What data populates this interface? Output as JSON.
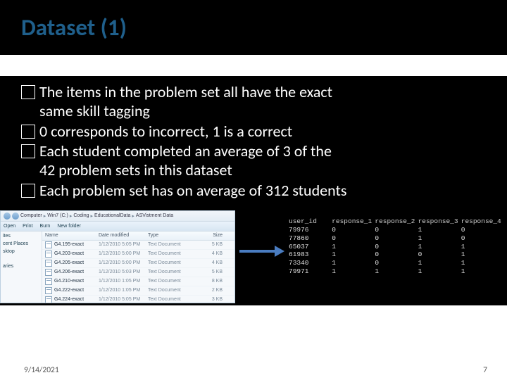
{
  "title": "Dataset (1)",
  "bullets": [
    {
      "first": "The items in the problem set all have the exact",
      "cont": "same skill tagging"
    },
    {
      "first": "0 corresponds to incorrect, 1 is a correct",
      "cont": ""
    },
    {
      "first": "Each student completed an average of 3 of the",
      "cont": "42 problem sets in this dataset"
    },
    {
      "first": "Each problem set has on average of 312 students",
      "cont": ""
    }
  ],
  "explorer": {
    "breadcrumb": [
      "Computer",
      "Win7 (C:)",
      "Coding",
      "EducationalData",
      "ASVistment Data"
    ],
    "toolbar": {
      "open": "Open",
      "print": "Print",
      "burn": "Burn",
      "newfolder": "New folder"
    },
    "sidebar": {
      "group1": "ites",
      "item1": "cent Places",
      "item2": "sktop",
      "group2": "aries"
    },
    "headers": {
      "name": "Name",
      "date": "Date modified",
      "type": "Type",
      "size": "Size"
    },
    "files": [
      {
        "name": "G4.195-exact",
        "date": "1/12/2010 5:05 PM",
        "type": "Text Document",
        "size": "5 KB"
      },
      {
        "name": "G4.203-exact",
        "date": "1/12/2010 5:00 PM",
        "type": "Text Document",
        "size": "4 KB"
      },
      {
        "name": "G4.205-exact",
        "date": "1/12/2010 5:00 PM",
        "type": "Text Document",
        "size": "4 KB"
      },
      {
        "name": "G4.206-exact",
        "date": "1/12/2010 5:03 PM",
        "type": "Text Document",
        "size": "5 KB"
      },
      {
        "name": "G4.210-exact",
        "date": "1/12/2010 1:05 PM",
        "type": "Text Document",
        "size": "8 KB"
      },
      {
        "name": "G4.222-exact",
        "date": "1/12/2010 1:05 PM",
        "type": "Text Document",
        "size": "2 KB"
      },
      {
        "name": "G4.224-exact",
        "date": "1/12/2010 5:05 PM",
        "type": "Text Document",
        "size": "3 KB"
      }
    ]
  },
  "datatable": {
    "headers": [
      "user_id",
      "response_1",
      "response_2",
      "response_3",
      "response_4"
    ],
    "rows": [
      [
        "79976",
        "0",
        "0",
        "1",
        "0"
      ],
      [
        "77860",
        "0",
        "0",
        "1",
        "0"
      ],
      [
        "65037",
        "1",
        "0",
        "1",
        "1"
      ],
      [
        "61983",
        "1",
        "0",
        "0",
        "1"
      ],
      [
        "73340",
        "1",
        "0",
        "1",
        "1"
      ],
      [
        "79971",
        "1",
        "1",
        "1",
        "1"
      ]
    ]
  },
  "footer": {
    "date": "9/14/2021",
    "page": "7"
  }
}
